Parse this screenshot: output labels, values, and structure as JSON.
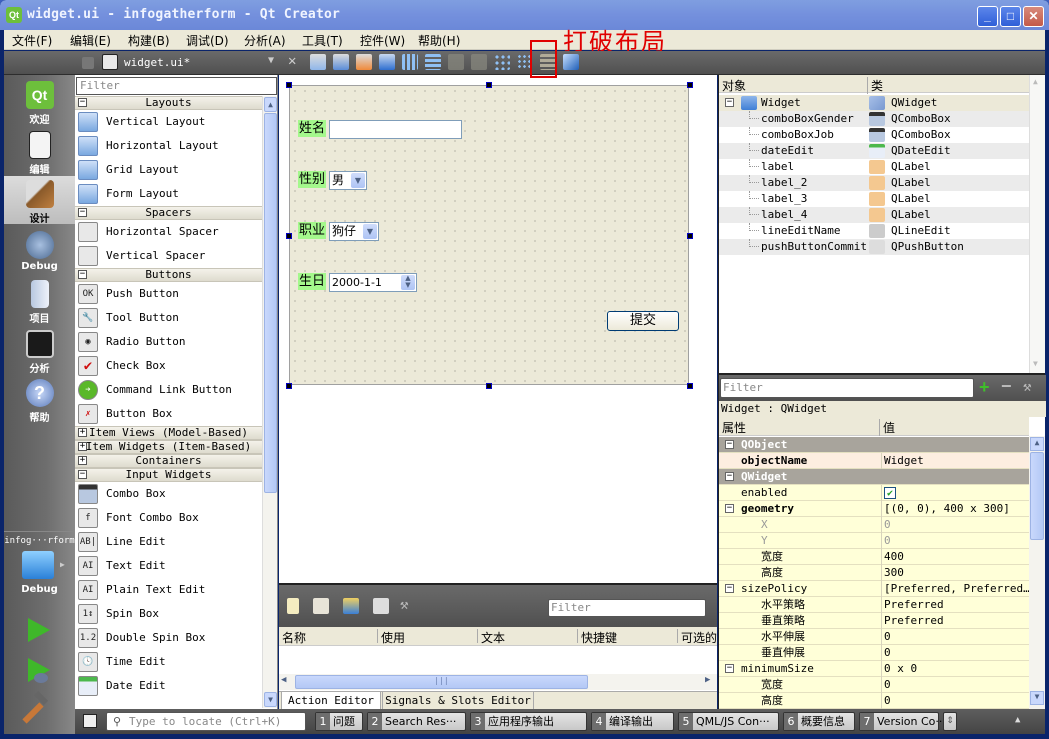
{
  "window": {
    "title": "widget.ui - infogatherform - Qt Creator",
    "app_icon": "qt-icon",
    "controls": [
      "minimize",
      "maximize",
      "close"
    ]
  },
  "menubar": {
    "items": [
      "文件(F)",
      "编辑(E)",
      "构建(B)",
      "调试(D)",
      "分析(A)",
      "工具(T)",
      "控件(W)",
      "帮助(H)"
    ]
  },
  "annotation": {
    "text": "打破布局"
  },
  "editor_toolbar": {
    "file_name": "widget.ui*",
    "tools": [
      "edit-widgets",
      "edit-signals-slots",
      "edit-buddies",
      "edit-tab-order",
      "layout-horizontal",
      "layout-vertical",
      "layout-horizontal-splitter",
      "layout-vertical-splitter",
      "layout-form",
      "layout-grid",
      "break-layout",
      "adjust-size"
    ]
  },
  "modes": [
    {
      "label": "欢迎",
      "icon": "qt-welcome-icon"
    },
    {
      "label": "编辑",
      "icon": "edit-icon"
    },
    {
      "label": "设计",
      "icon": "design-icon",
      "active": true
    },
    {
      "label": "Debug",
      "icon": "debug-icon"
    },
    {
      "label": "项目",
      "icon": "project-icon"
    },
    {
      "label": "分析",
      "icon": "analyze-icon"
    },
    {
      "label": "帮助",
      "icon": "help-icon"
    }
  ],
  "kit": {
    "project": "infog···rform",
    "config": "Debug"
  },
  "widget_box": {
    "filter_placeholder": "Filter",
    "categories": [
      {
        "name": "Layouts",
        "expanded": true,
        "items": [
          "Vertical Layout",
          "Horizontal Layout",
          "Grid Layout",
          "Form Layout"
        ]
      },
      {
        "name": "Spacers",
        "expanded": true,
        "items": [
          "Horizontal Spacer",
          "Vertical Spacer"
        ]
      },
      {
        "name": "Buttons",
        "expanded": true,
        "items": [
          "Push Button",
          "Tool Button",
          "Radio Button",
          "Check Box",
          "Command Link Button",
          "Button Box"
        ]
      },
      {
        "name": "Item Views (Model-Based)",
        "expanded": false,
        "items": []
      },
      {
        "name": "Item Widgets (Item-Based)",
        "expanded": false,
        "items": []
      },
      {
        "name": "Containers",
        "expanded": false,
        "items": []
      },
      {
        "name": "Input Widgets",
        "expanded": true,
        "items": [
          "Combo Box",
          "Font Combo Box",
          "Line Edit",
          "Text Edit",
          "Plain Text Edit",
          "Spin Box",
          "Double Spin Box",
          "Time Edit",
          "Date Edit"
        ]
      }
    ]
  },
  "form": {
    "name_label": "姓名",
    "name_value": "",
    "gender_label": "性别",
    "gender_value": "男",
    "job_label": "职业",
    "job_value": "狗仔",
    "birthday_label": "生日",
    "birthday_value": "2000-1-1",
    "submit_label": "提交"
  },
  "action_editor": {
    "filter_placeholder": "Filter",
    "columns": [
      "名称",
      "使用",
      "文本",
      "快捷键",
      "可选的"
    ],
    "tabs": [
      "Action Editor",
      "Signals & Slots Editor"
    ],
    "active_tab": "Action Editor"
  },
  "object_inspector": {
    "columns": [
      "对象",
      "类"
    ],
    "rows": [
      {
        "object": "Widget",
        "class": "QWidget",
        "root": true
      },
      {
        "object": "comboBoxGender",
        "class": "QComboBox"
      },
      {
        "object": "comboBoxJob",
        "class": "QComboBox"
      },
      {
        "object": "dateEdit",
        "class": "QDateEdit"
      },
      {
        "object": "label",
        "class": "QLabel"
      },
      {
        "object": "label_2",
        "class": "QLabel"
      },
      {
        "object": "label_3",
        "class": "QLabel"
      },
      {
        "object": "label_4",
        "class": "QLabel"
      },
      {
        "object": "lineEditName",
        "class": "QLineEdit"
      },
      {
        "object": "pushButtonCommit",
        "class": "QPushButton"
      }
    ]
  },
  "property_editor": {
    "filter_placeholder": "Filter",
    "subtitle": "Widget : QWidget",
    "columns": [
      "属性",
      "值"
    ],
    "rows": [
      {
        "kind": "group",
        "name": "QObject"
      },
      {
        "kind": "prop",
        "name": "objectName",
        "value": "Widget",
        "bold": true,
        "style": "o"
      },
      {
        "kind": "group",
        "name": "QWidget"
      },
      {
        "kind": "prop",
        "name": "enabled",
        "value": "✔",
        "checkbox": true,
        "style": "y"
      },
      {
        "kind": "prop",
        "name": "geometry",
        "value": "[(0, 0), 400 x 300]",
        "bold": true,
        "expander": true,
        "style": "y"
      },
      {
        "kind": "sub",
        "name": "X",
        "value": "0",
        "dim": true,
        "style": "y"
      },
      {
        "kind": "sub",
        "name": "Y",
        "value": "0",
        "dim": true,
        "style": "y"
      },
      {
        "kind": "sub",
        "name": "宽度",
        "value": "400",
        "style": "y"
      },
      {
        "kind": "sub",
        "name": "高度",
        "value": "300",
        "style": "y"
      },
      {
        "kind": "prop",
        "name": "sizePolicy",
        "value": "[Preferred, Preferred…",
        "expander": true,
        "style": "y"
      },
      {
        "kind": "sub",
        "name": "水平策略",
        "value": "Preferred",
        "style": "y"
      },
      {
        "kind": "sub",
        "name": "垂直策略",
        "value": "Preferred",
        "style": "y"
      },
      {
        "kind": "sub",
        "name": "水平伸展",
        "value": "0",
        "style": "y"
      },
      {
        "kind": "sub",
        "name": "垂直伸展",
        "value": "0",
        "style": "y"
      },
      {
        "kind": "prop",
        "name": "minimumSize",
        "value": "0 x 0",
        "expander": true,
        "style": "y"
      },
      {
        "kind": "sub",
        "name": "宽度",
        "value": "0",
        "style": "y"
      },
      {
        "kind": "sub",
        "name": "高度",
        "value": "0",
        "style": "y"
      }
    ]
  },
  "statusbar": {
    "locate_placeholder": "Type to locate (Ctrl+K)",
    "panes": [
      {
        "num": "1",
        "label": "问题"
      },
      {
        "num": "2",
        "label": "Search Res···"
      },
      {
        "num": "3",
        "label": "应用程序输出"
      },
      {
        "num": "4",
        "label": "编译输出"
      },
      {
        "num": "5",
        "label": "QML/JS Con···"
      },
      {
        "num": "6",
        "label": "概要信息"
      },
      {
        "num": "7",
        "label": "Version Co···"
      }
    ]
  }
}
